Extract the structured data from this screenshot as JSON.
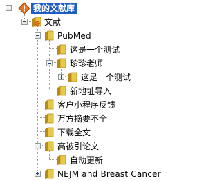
{
  "tree": {
    "root_label": "我的文献库",
    "nodes": [
      {
        "label": "文献"
      },
      {
        "label": "PubMed"
      },
      {
        "label": "这是一个测试"
      },
      {
        "label": "珍珍老师"
      },
      {
        "label": "这是一个测试"
      },
      {
        "label": "新地址导入"
      },
      {
        "label": "客户小程序反馈"
      },
      {
        "label": "万方摘要不全"
      },
      {
        "label": "下载全文"
      },
      {
        "label": "高被引论文"
      },
      {
        "label": "自动更新"
      },
      {
        "label": "NEJM and Breast Cancer"
      }
    ]
  },
  "colors": {
    "selection": "#1c5ec6",
    "folder_body": "#e8c84a",
    "folder_dark": "#b88a1a",
    "root_icon": "#e8741c",
    "guide": "#a0a0a0"
  },
  "icons": {
    "root": "warning-diamond-icon",
    "folder": "folder-icon",
    "expander": "tree-toggle-icon"
  }
}
